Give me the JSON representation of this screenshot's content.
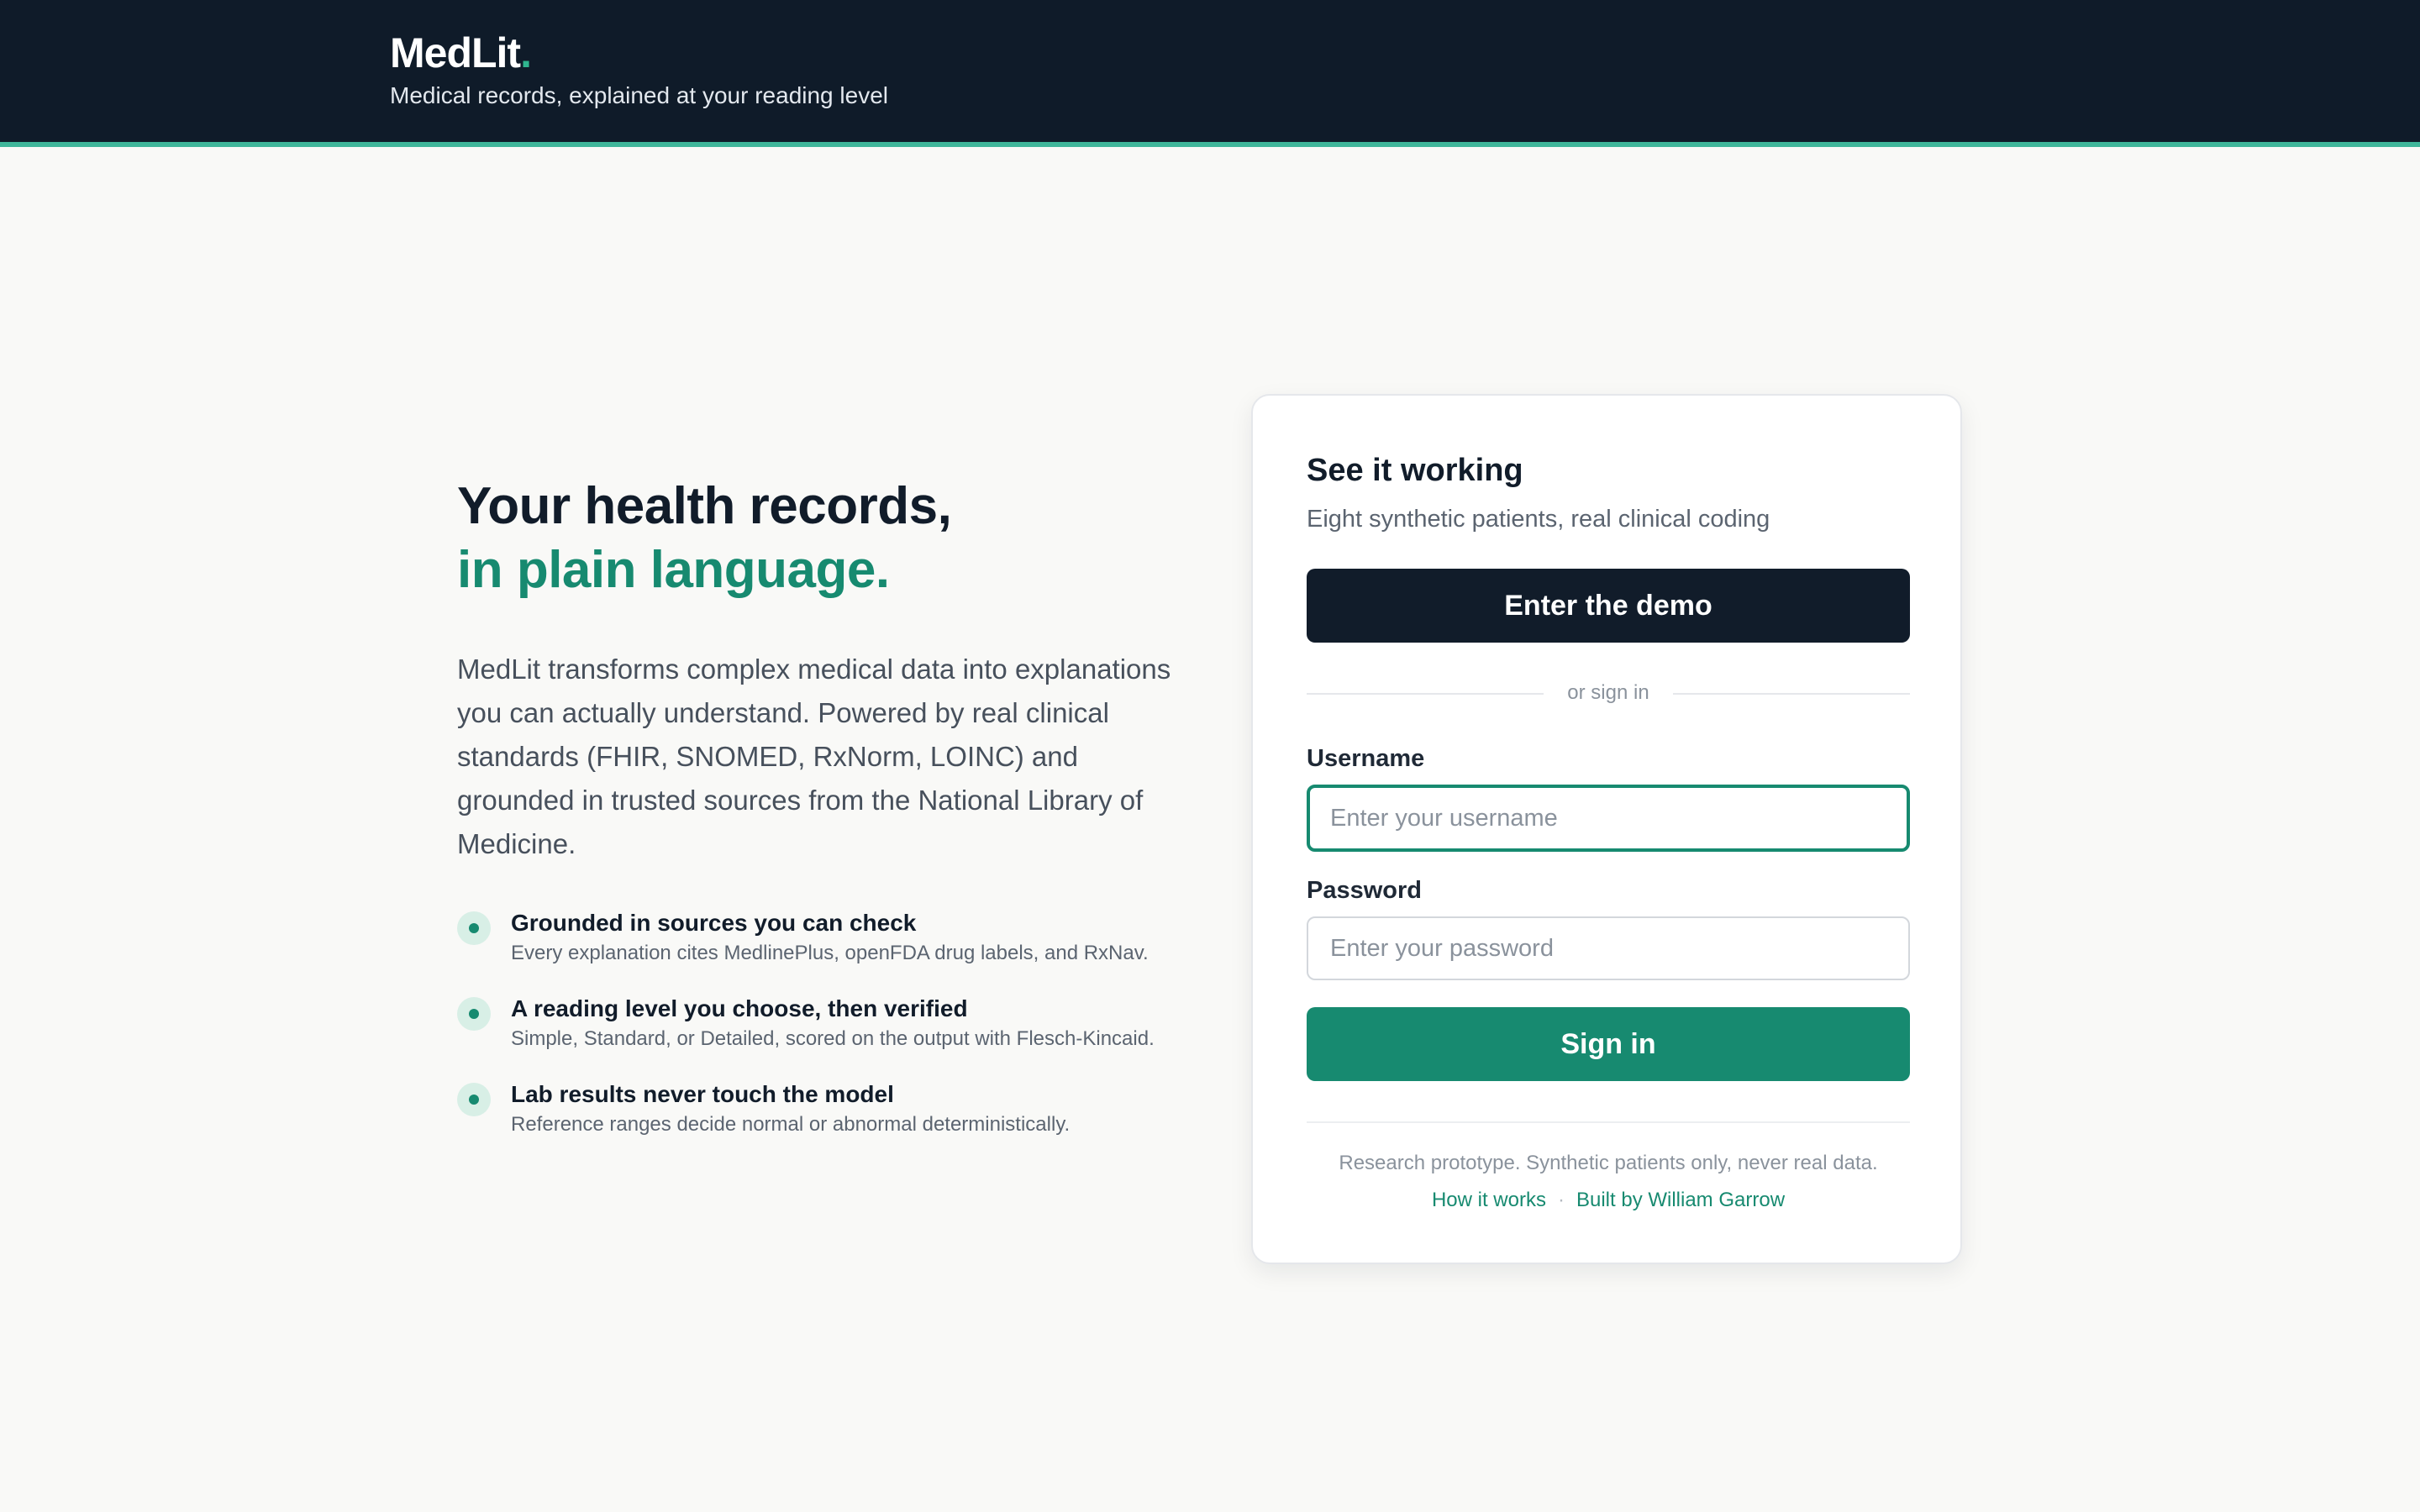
{
  "header": {
    "brand": "MedLit",
    "brand_dot": ".",
    "tagline": "Medical records, explained at your reading level"
  },
  "hero": {
    "title_line1": "Your health records,",
    "title_line2": "in plain language.",
    "lede": "MedLit transforms complex medical data into explanations you can actually understand. Powered by real clinical standards (FHIR, SNOMED, RxNorm, LOINC) and grounded in trusted sources from the National Library of Medicine.",
    "features": [
      {
        "title": "Grounded in sources you can check",
        "desc": "Every explanation cites MedlinePlus, openFDA drug labels, and RxNav."
      },
      {
        "title": "A reading level you choose, then verified",
        "desc": "Simple, Standard, or Detailed, scored on the output with Flesch-Kincaid."
      },
      {
        "title": "Lab results never touch the model",
        "desc": "Reference ranges decide normal or abnormal deterministically."
      }
    ]
  },
  "card": {
    "title": "See it working",
    "subtitle": "Eight synthetic patients, real clinical coding",
    "demo_button": "Enter the demo",
    "divider": "or sign in",
    "username_label": "Username",
    "username_placeholder": "Enter your username",
    "password_label": "Password",
    "password_placeholder": "Enter your password",
    "signin_button": "Sign in",
    "note": "Research prototype. Synthetic patients only, never real data.",
    "link_how": "How it works",
    "link_sep": "·",
    "link_built": "Built by William Garrow"
  },
  "colors": {
    "accent": "#178a70",
    "header_bg": "#0f1b29",
    "dark_button": "#111c2a"
  }
}
